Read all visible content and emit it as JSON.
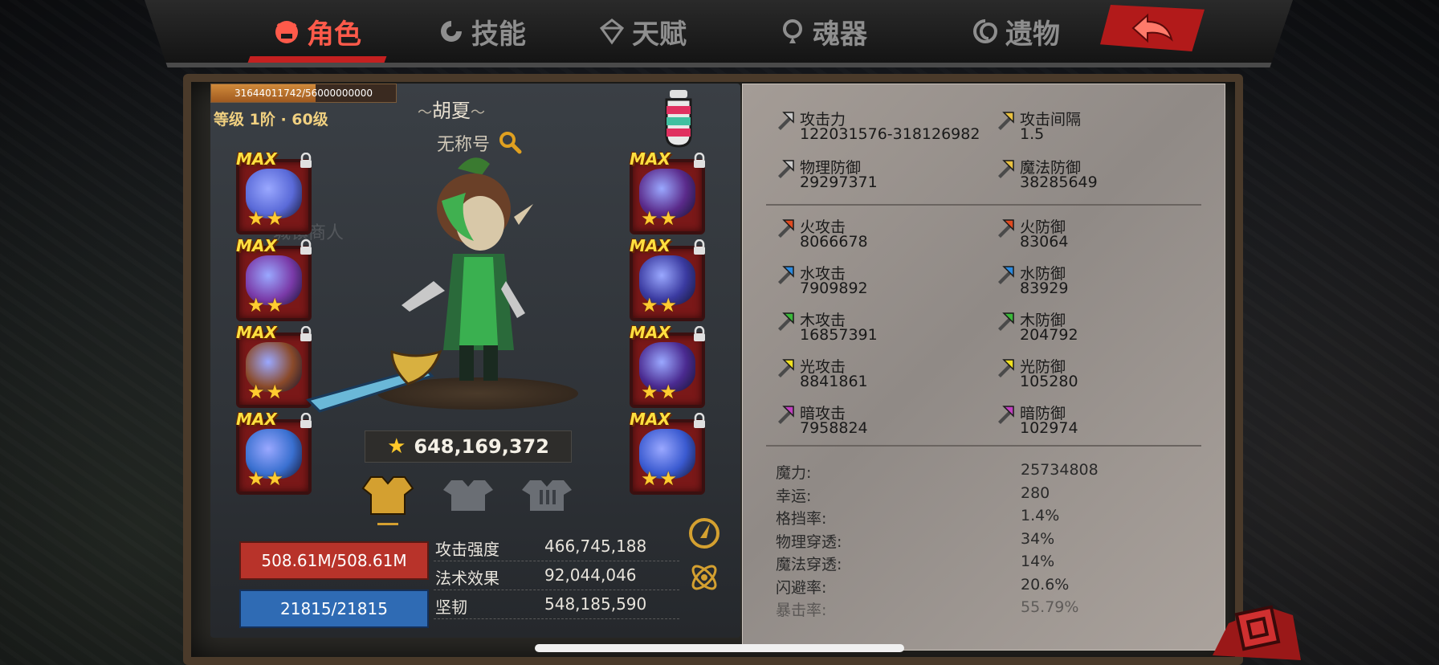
{
  "tabs": [
    {
      "label": "角色",
      "icon": "demon-face-icon",
      "active": true
    },
    {
      "label": "技能",
      "icon": "skill-swirl-icon",
      "active": false
    },
    {
      "label": "天赋",
      "icon": "talent-gem-icon",
      "active": false
    },
    {
      "label": "魂器",
      "icon": "soul-vessel-icon",
      "active": false
    },
    {
      "label": "遗物",
      "icon": "relic-spiral-icon",
      "active": false
    }
  ],
  "back_icon": "back-arrow-icon",
  "character": {
    "xp_text": "31644011742/56000000000",
    "xp_fraction": 0.565,
    "level_text": "等级 1阶 · 60级",
    "name": "胡夏",
    "title": "无称号",
    "power": "648,169,372"
  },
  "equipment": {
    "max_label": "MAX",
    "stars": "★★",
    "left": [
      {
        "icon": "orb-relic-icon",
        "tone": "#5a6ad8"
      },
      {
        "icon": "gauntlet-icon",
        "tone": "#7a3aa8"
      },
      {
        "icon": "amulet-icon",
        "tone": "#8a4a2a"
      },
      {
        "icon": "ring-icon",
        "tone": "#3a70d0"
      }
    ],
    "right": [
      {
        "icon": "helmet-icon",
        "tone": "#5a2a8a"
      },
      {
        "icon": "armor-icon",
        "tone": "#3a3aa0"
      },
      {
        "icon": "boots-icon",
        "tone": "#4a2a90"
      },
      {
        "icon": "flame-cloak-icon",
        "tone": "#3a5ad0"
      }
    ]
  },
  "gear_tabs": [
    "armor-set-1-icon",
    "armor-set-2-icon",
    "armor-set-3-icon"
  ],
  "bars": {
    "hp": "508.61M/508.61M",
    "mp": "21815/21815"
  },
  "core_stats": [
    {
      "label": "攻击强度",
      "value": "466,745,188"
    },
    {
      "label": "法术效果",
      "value": "92,044,046"
    },
    {
      "label": "坚韧",
      "value": "548,185,590"
    }
  ],
  "main_stats": [
    {
      "name": "攻击力",
      "value": "122031576-318126982",
      "icon": "sword-icon",
      "col": 0
    },
    {
      "name": "攻击间隔",
      "value": "1.5",
      "icon": "gold-sword-icon",
      "col": 1
    },
    {
      "name": "物理防御",
      "value": "29297371",
      "icon": "shield-sword-icon",
      "col": 0
    },
    {
      "name": "魔法防御",
      "value": "38285649",
      "icon": "magic-shield-icon",
      "col": 1
    }
  ],
  "element_stats": [
    {
      "name": "火攻击",
      "value": "8066678",
      "icon": "fire-attack-icon",
      "color": "#e04a20"
    },
    {
      "name": "火防御",
      "value": "83064",
      "icon": "fire-defense-icon",
      "color": "#e04a20"
    },
    {
      "name": "水攻击",
      "value": "7909892",
      "icon": "water-attack-icon",
      "color": "#2a8ae0"
    },
    {
      "name": "水防御",
      "value": "83929",
      "icon": "water-defense-icon",
      "color": "#2a8ae0"
    },
    {
      "name": "木攻击",
      "value": "16857391",
      "icon": "wood-attack-icon",
      "color": "#3ab83a"
    },
    {
      "name": "木防御",
      "value": "204792",
      "icon": "wood-defense-icon",
      "color": "#3ab83a"
    },
    {
      "name": "光攻击",
      "value": "8841861",
      "icon": "light-attack-icon",
      "color": "#f0e020"
    },
    {
      "name": "光防御",
      "value": "105280",
      "icon": "light-defense-icon",
      "color": "#f0e020"
    },
    {
      "name": "暗攻击",
      "value": "7958824",
      "icon": "dark-attack-icon",
      "color": "#c040c0"
    },
    {
      "name": "暗防御",
      "value": "102974",
      "icon": "dark-defense-icon",
      "color": "#c040c0"
    }
  ],
  "misc_stats": [
    {
      "label": "魔力:",
      "value": "25734808"
    },
    {
      "label": "幸运:",
      "value": "280"
    },
    {
      "label": "格挡率:",
      "value": "1.4%"
    },
    {
      "label": "物理穿透:",
      "value": "34%"
    },
    {
      "label": "魔法穿透:",
      "value": "14%"
    },
    {
      "label": "闪避率:",
      "value": "20.6%"
    },
    {
      "label": "暴击率:",
      "value": "55.79%"
    }
  ]
}
